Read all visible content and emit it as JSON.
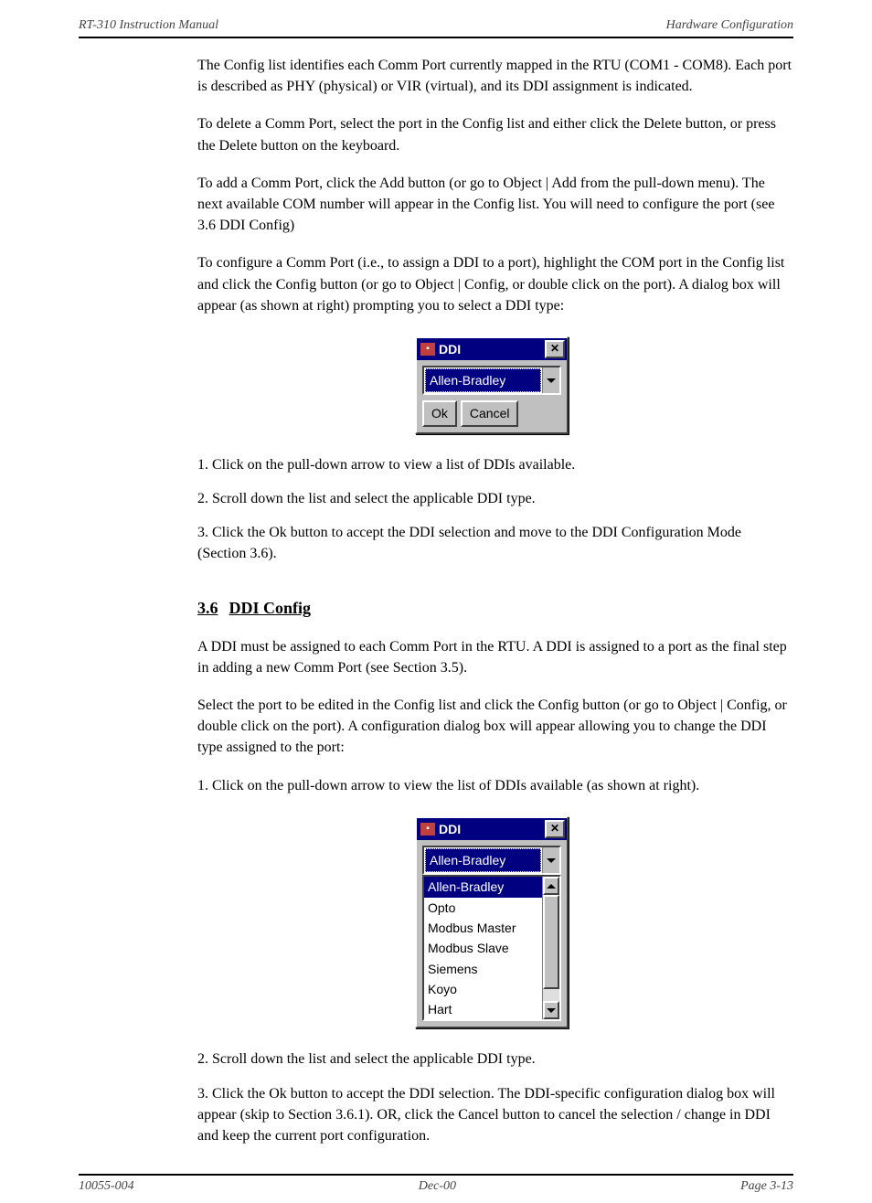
{
  "header": {
    "left": "RT-310 Instruction Manual",
    "right": "Hardware Configuration"
  },
  "footer": {
    "left": "10055-004",
    "center": "Dec-00",
    "right": "Page 3-13"
  },
  "s35": {
    "p1": "The Config list identifies each Comm Port currently mapped in the RTU (COM1 - COM8). Each port is described as PHY (physical) or VIR (virtual), and its DDI assignment is indicated.",
    "p2": "To delete a Comm Port, select the port in the Config list and either click the Delete button, or press the Delete button on the keyboard.",
    "p3": "To add a Comm Port, click the Add button (or go to Object | Add from the pull-down menu). The next available COM number will appear in the Config list. You will need to configure the port (see 3.6 DDI Config)",
    "p4": "To configure a Comm Port (i.e., to assign a DDI to a port), highlight the COM port in the Config list and click the Config button (or go to Object | Config, or double click on the port). A dialog box will appear (as shown at right) prompting you to select a DDI type:",
    "items": {
      "i1": "1.  Click on the pull-down arrow to view a list of DDIs available.",
      "i2": "2.  Scroll down the list and select the applicable DDI type.",
      "i3": "3.  Click the Ok button to accept the DDI selection and move to the DDI Configuration Mode (Section 3.6)."
    }
  },
  "s36": {
    "num": "3.6",
    "title": "DDI Config",
    "p1": "A DDI must be assigned to each Comm Port in the RTU. A DDI is assigned to a port as the final step in adding a new Comm Port (see Section 3.5).",
    "p2": "Select the port to be edited in the Config list and click the Config button (or go to Object | Config, or double click on the port). A configuration dialog box will appear allowing you to change the DDI type assigned to the port:",
    "items": {
      "i1": "1.  Click on the pull-down arrow to view the list of DDIs available (as shown at right).",
      "i2": "2.  Scroll down the list and select the applicable DDI type.",
      "i3": "3.  Click the Ok button to accept the DDI selection. The DDI-specific configuration dialog box will appear (skip to Section 3.6.1). OR, click the Cancel button to cancel the selection / change in DDI and keep the current port configuration."
    }
  },
  "dialog": {
    "title": "DDI",
    "selected": "Allen-Bradley",
    "ok": "Ok",
    "cancel": "Cancel",
    "options": [
      "Allen-Bradley",
      "Opto",
      "Modbus Master",
      "Modbus Slave",
      "Siemens",
      "Koyo",
      "Hart"
    ]
  }
}
